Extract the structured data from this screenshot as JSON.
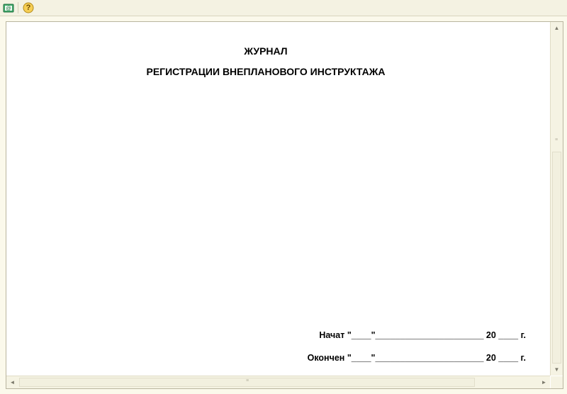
{
  "toolbar": {
    "buttons": [
      {
        "icon": "email-icon"
      },
      {
        "icon": "help-icon",
        "glyph": "?"
      }
    ]
  },
  "document": {
    "title_line1": "ЖУРНАЛ",
    "title_line2": "РЕГИСТРАЦИИ ВНЕПЛАНОВОГО ИНСТРУКТАЖА",
    "started_line": "Начат \"____\"______________________ 20 ____ г.",
    "ended_line": "Окончен \"____\"______________________ 20 ____ г."
  },
  "scrollbars": {
    "vertical": {
      "up_glyph": "▲",
      "down_glyph": "▼",
      "grip": "≡"
    },
    "horizontal": {
      "left_glyph": "◄",
      "right_glyph": "►",
      "grip": "≡"
    }
  }
}
